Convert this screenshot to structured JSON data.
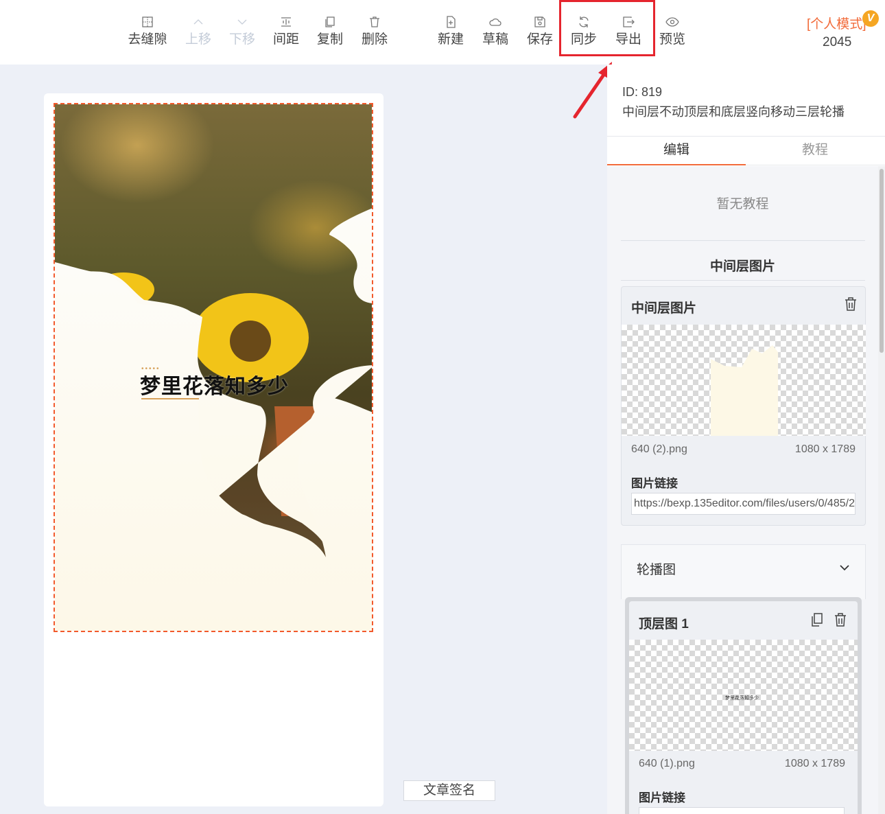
{
  "toolbar": {
    "tools": [
      {
        "label": "去缝隙",
        "icon": "grid-dots-icon",
        "disabled": false
      },
      {
        "label": "上移",
        "icon": "chevron-up-icon",
        "disabled": true
      },
      {
        "label": "下移",
        "icon": "chevron-down-icon",
        "disabled": true
      },
      {
        "label": "间距",
        "icon": "spacing-icon",
        "disabled": false
      },
      {
        "label": "复制",
        "icon": "copy-icon",
        "disabled": false
      },
      {
        "label": "删除",
        "icon": "trash-icon",
        "disabled": false
      },
      {
        "label": "新建",
        "icon": "new-file-icon",
        "disabled": false
      },
      {
        "label": "草稿",
        "icon": "cloud-icon",
        "disabled": false
      },
      {
        "label": "保存",
        "icon": "save-icon",
        "disabled": false
      },
      {
        "label": "同步",
        "icon": "sync-icon",
        "disabled": false
      },
      {
        "label": "导出",
        "icon": "export-icon",
        "disabled": false
      },
      {
        "label": "预览",
        "icon": "eye-icon",
        "disabled": false
      }
    ],
    "mode_label": "[个人模式]",
    "vip_badge": "V",
    "count": "2045"
  },
  "canvas": {
    "poster_title": "梦里花落知多少",
    "poster_dots": "•••••",
    "signature_button": "文章签名"
  },
  "panel": {
    "id_line": "ID: 819",
    "template_name": "中间层不动顶层和底层竖向移动三层轮播",
    "tabs": [
      "编辑",
      "教程"
    ],
    "no_tutorial": "暂无教程",
    "section_title": "中间层图片",
    "middle_card": {
      "title": "中间层图片",
      "file_name": "640 (2).png",
      "file_size": "1080 x 1789",
      "link_label": "图片链接",
      "link_value": "https://bexp.135editor.com/files/users/0/485/2"
    },
    "carousel_title": "轮播图",
    "top_card": {
      "title": "顶层图 1",
      "thumb_text": "梦里花落知多少",
      "file_name": "640 (1).png",
      "file_size": "1080 x 1789",
      "link_label": "图片链接"
    }
  },
  "colors": {
    "accent": "#f26b3a",
    "highlight": "#e5252e",
    "dashed_border": "#f2592c"
  }
}
